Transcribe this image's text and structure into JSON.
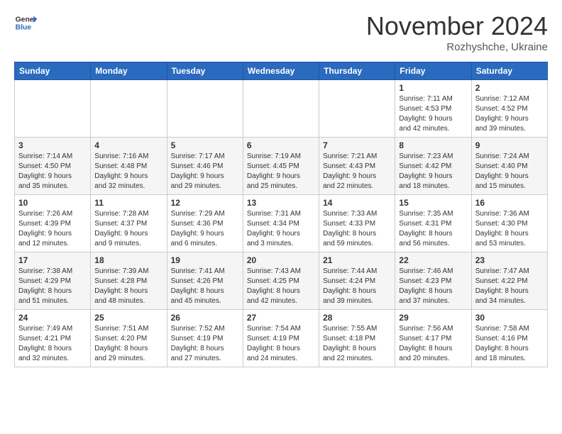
{
  "header": {
    "logo_general": "General",
    "logo_blue": "Blue",
    "month_title": "November 2024",
    "location": "Rozhyshche, Ukraine"
  },
  "weekdays": [
    "Sunday",
    "Monday",
    "Tuesday",
    "Wednesday",
    "Thursday",
    "Friday",
    "Saturday"
  ],
  "weeks": [
    [
      {
        "day": "",
        "info": ""
      },
      {
        "day": "",
        "info": ""
      },
      {
        "day": "",
        "info": ""
      },
      {
        "day": "",
        "info": ""
      },
      {
        "day": "",
        "info": ""
      },
      {
        "day": "1",
        "info": "Sunrise: 7:11 AM\nSunset: 4:53 PM\nDaylight: 9 hours\nand 42 minutes."
      },
      {
        "day": "2",
        "info": "Sunrise: 7:12 AM\nSunset: 4:52 PM\nDaylight: 9 hours\nand 39 minutes."
      }
    ],
    [
      {
        "day": "3",
        "info": "Sunrise: 7:14 AM\nSunset: 4:50 PM\nDaylight: 9 hours\nand 35 minutes."
      },
      {
        "day": "4",
        "info": "Sunrise: 7:16 AM\nSunset: 4:48 PM\nDaylight: 9 hours\nand 32 minutes."
      },
      {
        "day": "5",
        "info": "Sunrise: 7:17 AM\nSunset: 4:46 PM\nDaylight: 9 hours\nand 29 minutes."
      },
      {
        "day": "6",
        "info": "Sunrise: 7:19 AM\nSunset: 4:45 PM\nDaylight: 9 hours\nand 25 minutes."
      },
      {
        "day": "7",
        "info": "Sunrise: 7:21 AM\nSunset: 4:43 PM\nDaylight: 9 hours\nand 22 minutes."
      },
      {
        "day": "8",
        "info": "Sunrise: 7:23 AM\nSunset: 4:42 PM\nDaylight: 9 hours\nand 18 minutes."
      },
      {
        "day": "9",
        "info": "Sunrise: 7:24 AM\nSunset: 4:40 PM\nDaylight: 9 hours\nand 15 minutes."
      }
    ],
    [
      {
        "day": "10",
        "info": "Sunrise: 7:26 AM\nSunset: 4:39 PM\nDaylight: 9 hours\nand 12 minutes."
      },
      {
        "day": "11",
        "info": "Sunrise: 7:28 AM\nSunset: 4:37 PM\nDaylight: 9 hours\nand 9 minutes."
      },
      {
        "day": "12",
        "info": "Sunrise: 7:29 AM\nSunset: 4:36 PM\nDaylight: 9 hours\nand 6 minutes."
      },
      {
        "day": "13",
        "info": "Sunrise: 7:31 AM\nSunset: 4:34 PM\nDaylight: 9 hours\nand 3 minutes."
      },
      {
        "day": "14",
        "info": "Sunrise: 7:33 AM\nSunset: 4:33 PM\nDaylight: 8 hours\nand 59 minutes."
      },
      {
        "day": "15",
        "info": "Sunrise: 7:35 AM\nSunset: 4:31 PM\nDaylight: 8 hours\nand 56 minutes."
      },
      {
        "day": "16",
        "info": "Sunrise: 7:36 AM\nSunset: 4:30 PM\nDaylight: 8 hours\nand 53 minutes."
      }
    ],
    [
      {
        "day": "17",
        "info": "Sunrise: 7:38 AM\nSunset: 4:29 PM\nDaylight: 8 hours\nand 51 minutes."
      },
      {
        "day": "18",
        "info": "Sunrise: 7:39 AM\nSunset: 4:28 PM\nDaylight: 8 hours\nand 48 minutes."
      },
      {
        "day": "19",
        "info": "Sunrise: 7:41 AM\nSunset: 4:26 PM\nDaylight: 8 hours\nand 45 minutes."
      },
      {
        "day": "20",
        "info": "Sunrise: 7:43 AM\nSunset: 4:25 PM\nDaylight: 8 hours\nand 42 minutes."
      },
      {
        "day": "21",
        "info": "Sunrise: 7:44 AM\nSunset: 4:24 PM\nDaylight: 8 hours\nand 39 minutes."
      },
      {
        "day": "22",
        "info": "Sunrise: 7:46 AM\nSunset: 4:23 PM\nDaylight: 8 hours\nand 37 minutes."
      },
      {
        "day": "23",
        "info": "Sunrise: 7:47 AM\nSunset: 4:22 PM\nDaylight: 8 hours\nand 34 minutes."
      }
    ],
    [
      {
        "day": "24",
        "info": "Sunrise: 7:49 AM\nSunset: 4:21 PM\nDaylight: 8 hours\nand 32 minutes."
      },
      {
        "day": "25",
        "info": "Sunrise: 7:51 AM\nSunset: 4:20 PM\nDaylight: 8 hours\nand 29 minutes."
      },
      {
        "day": "26",
        "info": "Sunrise: 7:52 AM\nSunset: 4:19 PM\nDaylight: 8 hours\nand 27 minutes."
      },
      {
        "day": "27",
        "info": "Sunrise: 7:54 AM\nSunset: 4:19 PM\nDaylight: 8 hours\nand 24 minutes."
      },
      {
        "day": "28",
        "info": "Sunrise: 7:55 AM\nSunset: 4:18 PM\nDaylight: 8 hours\nand 22 minutes."
      },
      {
        "day": "29",
        "info": "Sunrise: 7:56 AM\nSunset: 4:17 PM\nDaylight: 8 hours\nand 20 minutes."
      },
      {
        "day": "30",
        "info": "Sunrise: 7:58 AM\nSunset: 4:16 PM\nDaylight: 8 hours\nand 18 minutes."
      }
    ]
  ]
}
